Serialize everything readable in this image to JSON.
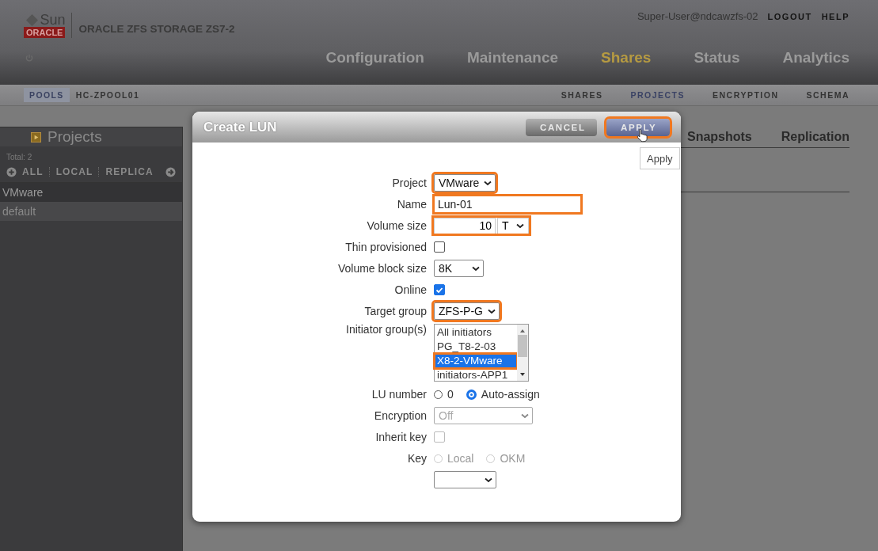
{
  "header": {
    "logo": {
      "sun": "Sun",
      "oracle": "ORACLE"
    },
    "product": "ORACLE ZFS STORAGE ZS7-2",
    "user": "Super-User@ndcawzfs-02",
    "links": [
      "LOGOUT",
      "HELP"
    ],
    "nav": [
      {
        "label": "Configuration",
        "selected": false
      },
      {
        "label": "Maintenance",
        "selected": false
      },
      {
        "label": "Shares",
        "selected": true
      },
      {
        "label": "Status",
        "selected": false
      },
      {
        "label": "Analytics",
        "selected": false
      }
    ]
  },
  "subnav": {
    "pool_button": "POOLS",
    "pool": "HC-ZPOOL01",
    "tabs": [
      {
        "label": "SHARES",
        "selected": false
      },
      {
        "label": "PROJECTS",
        "selected": true
      },
      {
        "label": "ENCRYPTION",
        "selected": false
      },
      {
        "label": "SCHEMA",
        "selected": false
      }
    ]
  },
  "sidebar": {
    "title": "Projects",
    "total": "Total: 2",
    "filters": [
      "ALL",
      "LOCAL",
      "REPLICA"
    ],
    "items": [
      {
        "label": "VMware",
        "selected": true
      },
      {
        "label": "default",
        "selected": false
      }
    ]
  },
  "content": {
    "tabs": [
      "Snapshots",
      "Replication"
    ]
  },
  "dialog": {
    "title": "Create LUN",
    "buttons": [
      {
        "label": "CANCEL",
        "kind": "cancel",
        "highlighted": false
      },
      {
        "label": "APPLY",
        "kind": "apply",
        "highlighted": true
      }
    ],
    "tooltip": "Apply",
    "fields": [
      {
        "kind": "select",
        "label": "Project",
        "value": "VMware",
        "highlighted": true,
        "disabled": false
      },
      {
        "kind": "text",
        "label": "Name",
        "value": "Lun-01",
        "highlighted": true
      },
      {
        "kind": "size",
        "label": "Volume size",
        "value": "10",
        "unit": "T",
        "highlighted": true
      },
      {
        "kind": "checkbox",
        "label": "Thin provisioned",
        "checked": false,
        "disabled": false
      },
      {
        "kind": "select",
        "label": "Volume block size",
        "value": "8K",
        "highlighted": false,
        "disabled": false
      },
      {
        "kind": "checkbox",
        "label": "Online",
        "checked": true,
        "disabled": false
      },
      {
        "kind": "select",
        "label": "Target group",
        "value": "ZFS-P-G",
        "highlighted": true,
        "disabled": false
      },
      {
        "kind": "listbox",
        "label": "Initiator group(s)",
        "options": [
          {
            "label": "All initiators",
            "selected": false,
            "highlighted": false
          },
          {
            "label": "PG_T8-2-03",
            "selected": false,
            "highlighted": false
          },
          {
            "label": "X8-2-VMware",
            "selected": true,
            "highlighted": true
          },
          {
            "label": "initiators-APP1",
            "selected": false,
            "highlighted": false
          }
        ]
      },
      {
        "kind": "radio",
        "label": "LU number",
        "options": [
          {
            "label": "0",
            "selected": false
          },
          {
            "label": "Auto-assign",
            "selected": true
          }
        ],
        "disabled": false
      },
      {
        "kind": "select",
        "label": "Encryption",
        "value": "Off",
        "highlighted": false,
        "disabled": true
      },
      {
        "kind": "checkbox",
        "label": "Inherit key",
        "checked": false,
        "disabled": true
      },
      {
        "kind": "radio",
        "label": "Key",
        "options": [
          {
            "label": "Local",
            "selected": false
          },
          {
            "label": "OKM",
            "selected": false
          }
        ],
        "disabled": true
      },
      {
        "kind": "select",
        "highlighted": false,
        "disabled": false
      }
    ]
  }
}
